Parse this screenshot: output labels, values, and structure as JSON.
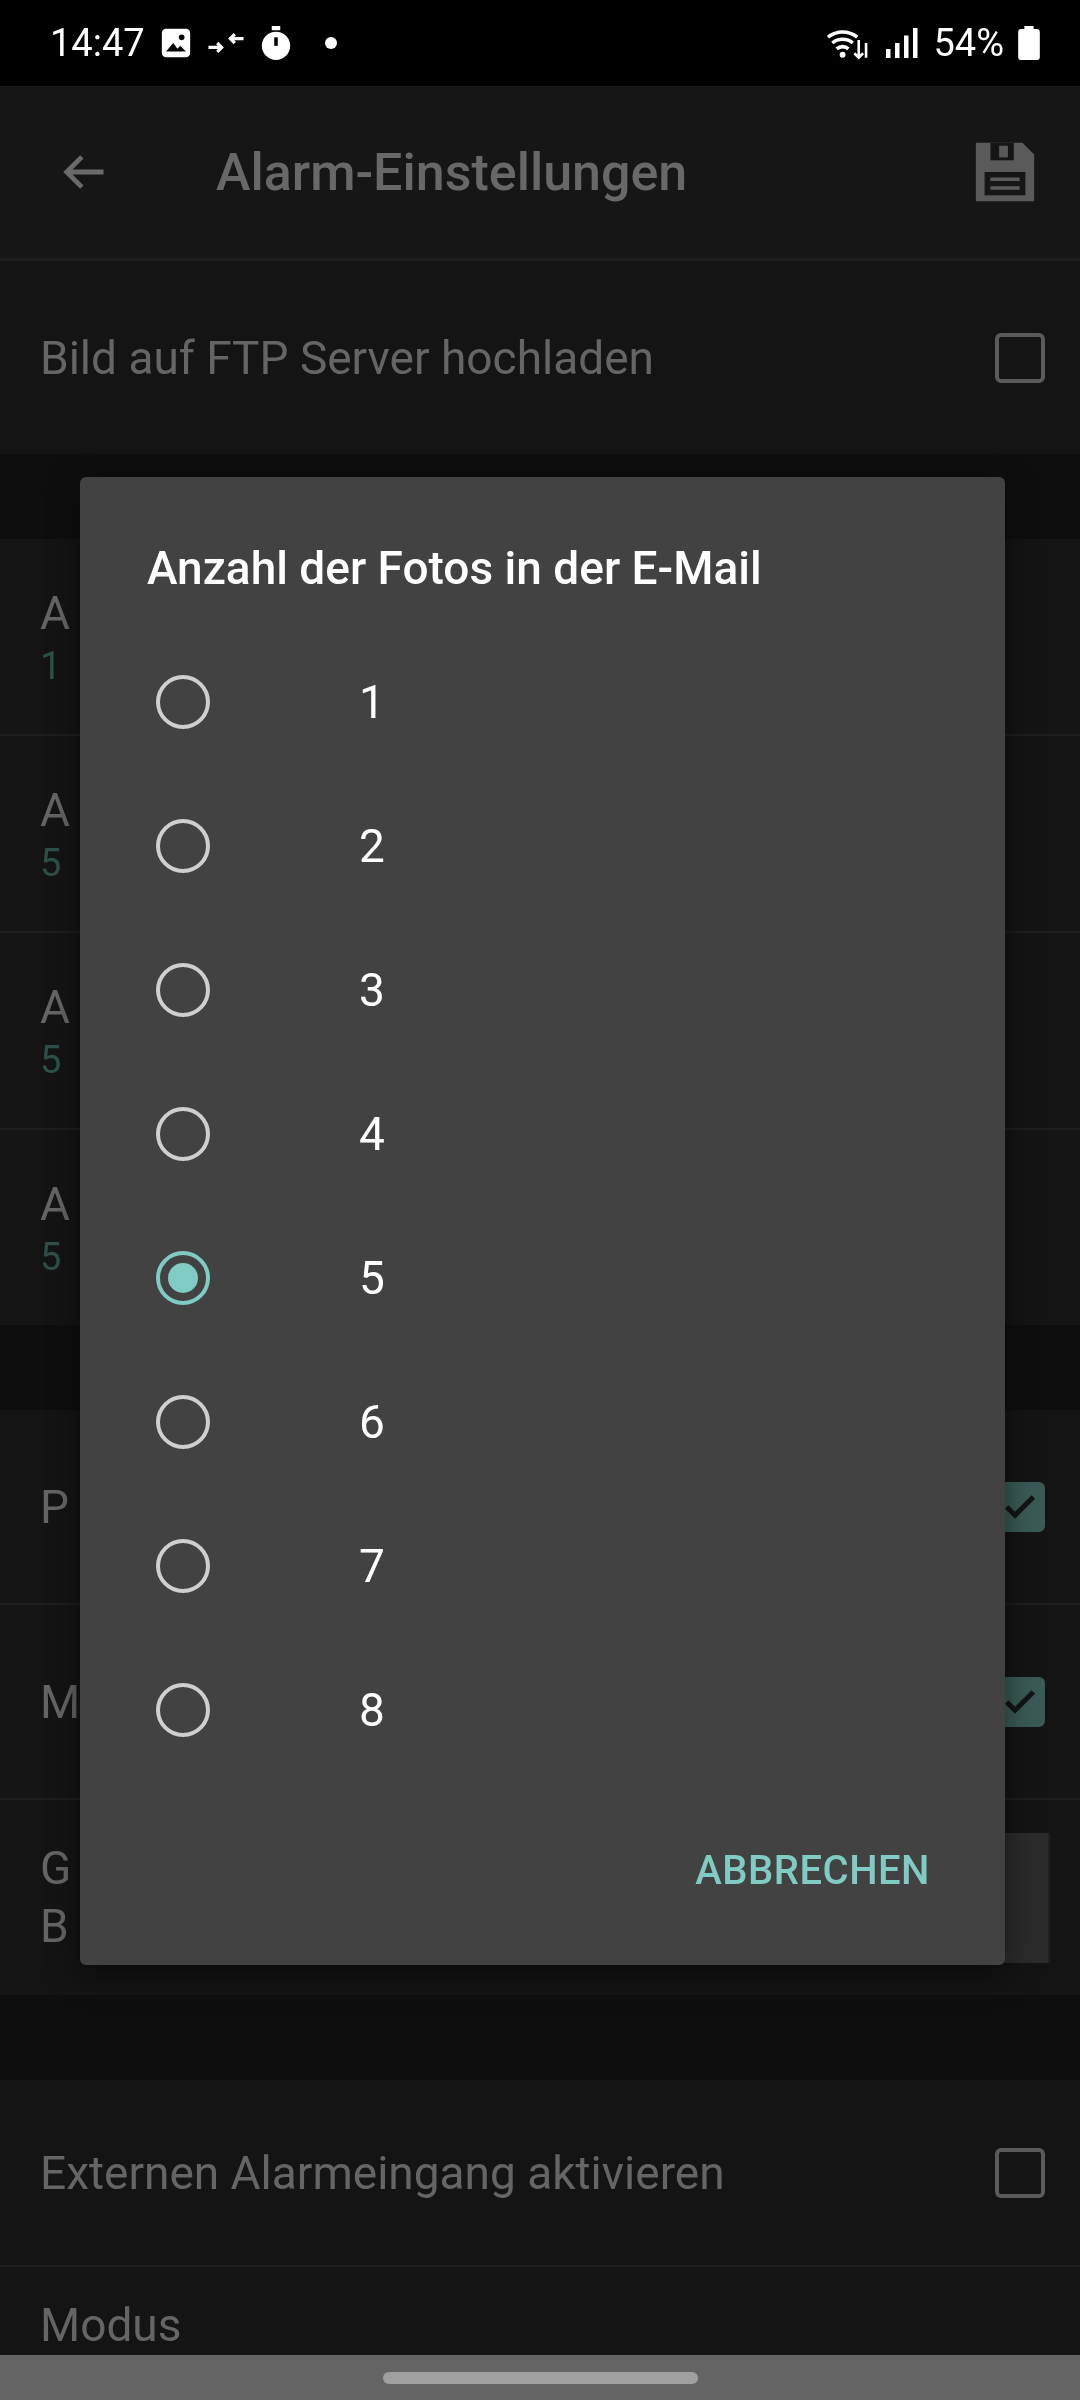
{
  "status_bar": {
    "time": "14:47",
    "battery": "54%"
  },
  "app_bar": {
    "title": "Alarm-Einstellungen"
  },
  "sections": [
    {
      "items": [
        {
          "kind": "checkbox",
          "title": "Bild auf FTP Server hochladen",
          "checked": false
        }
      ]
    },
    {
      "items": [
        {
          "kind": "value",
          "title": "A",
          "value": "1"
        },
        {
          "kind": "value",
          "title": "A",
          "value": "5"
        },
        {
          "kind": "value",
          "title": "A",
          "value": "5"
        },
        {
          "kind": "value",
          "title": "A",
          "value": "5"
        }
      ]
    },
    {
      "items": [
        {
          "kind": "checkbox",
          "title": "P",
          "checked": true
        },
        {
          "kind": "checkbox",
          "title": "M",
          "checked": true
        },
        {
          "kind": "segmented",
          "lines": [
            "G",
            "B"
          ]
        }
      ]
    },
    {
      "items": [
        {
          "kind": "checkbox",
          "title": "Externen Alarmeingang aktivieren",
          "checked": false
        },
        {
          "kind": "label",
          "title": "Modus"
        }
      ]
    }
  ],
  "dialog": {
    "title": "Anzahl der Fotos in der E-Mail",
    "options": [
      {
        "label": "1",
        "selected": false
      },
      {
        "label": "2",
        "selected": false
      },
      {
        "label": "3",
        "selected": false
      },
      {
        "label": "4",
        "selected": false
      },
      {
        "label": "5",
        "selected": true
      },
      {
        "label": "6",
        "selected": false
      },
      {
        "label": "7",
        "selected": false
      },
      {
        "label": "8",
        "selected": false
      }
    ],
    "button": "ABBRECHEN"
  }
}
